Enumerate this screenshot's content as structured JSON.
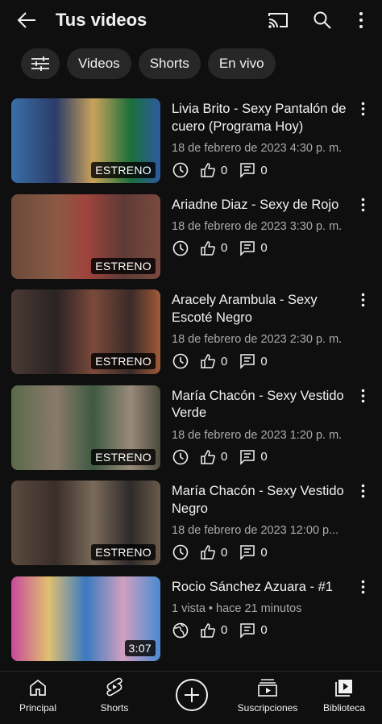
{
  "header": {
    "title": "Tus videos"
  },
  "chips": [
    "Videos",
    "Shorts",
    "En vivo"
  ],
  "videos": [
    {
      "title": "Livia Brito - Sexy Pantalón de cuero (Programa Hoy)",
      "meta": "18 de febrero de 2023 4:30 p. m.",
      "badge": "ESTRENO",
      "likes": "0",
      "comments": "0",
      "visibility": "clock-icon"
    },
    {
      "title": "Ariadne Diaz - Sexy de Rojo",
      "meta": "18 de febrero de 2023 3:30 p. m.",
      "badge": "ESTRENO",
      "likes": "0",
      "comments": "0",
      "visibility": "clock-icon"
    },
    {
      "title": "Aracely Arambula - Sexy Escoté Negro",
      "meta": "18 de febrero de 2023 2:30 p. m.",
      "badge": "ESTRENO",
      "likes": "0",
      "comments": "0",
      "visibility": "clock-icon"
    },
    {
      "title": "María Chacón - Sexy Vestido Verde",
      "meta": "18 de febrero de 2023 1:20 p. m.",
      "badge": "ESTRENO",
      "likes": "0",
      "comments": "0",
      "visibility": "clock-icon"
    },
    {
      "title": "María Chacón - Sexy Vestido Negro",
      "meta": "18 de febrero de 2023 12:00 p...",
      "badge": "ESTRENO",
      "likes": "0",
      "comments": "0",
      "visibility": "clock-icon"
    },
    {
      "title": "Rocio Sánchez Azuara - #1",
      "meta": "1 vista • hace 21 minutos",
      "badge": "3:07",
      "likes": "0",
      "comments": "0",
      "visibility": "globe-icon"
    }
  ],
  "bottom_nav": {
    "home": "Principal",
    "shorts": "Shorts",
    "subscriptions": "Suscripciones",
    "library": "Biblioteca"
  },
  "colors": {
    "background": "#0f0f0f",
    "chip": "#272727",
    "secondary_text": "#aaaaaa"
  }
}
